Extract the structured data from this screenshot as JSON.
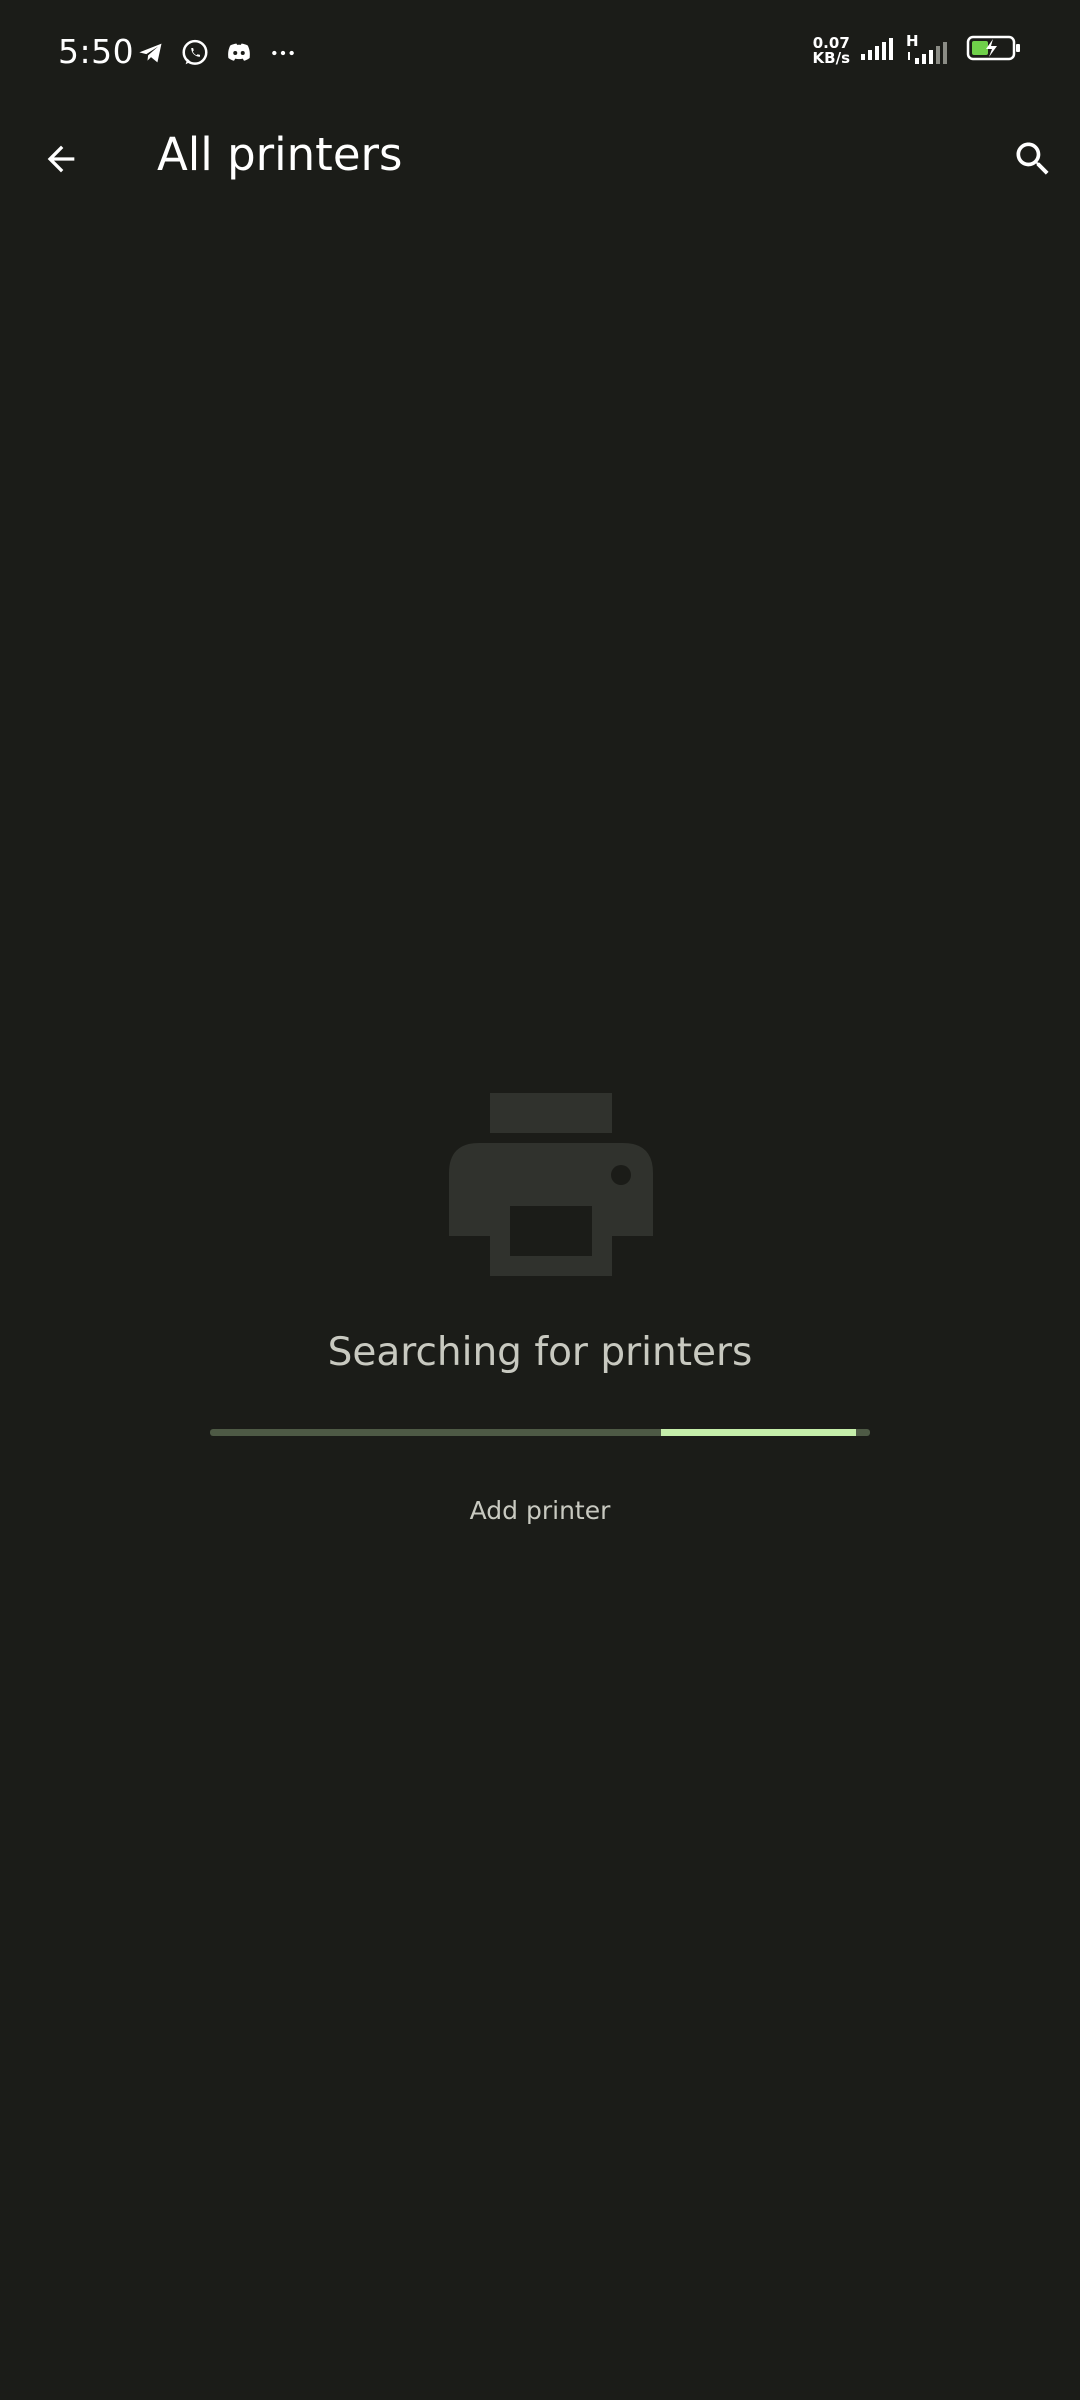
{
  "status_bar": {
    "time": "5:50",
    "notification_icons": [
      "telegram-icon",
      "whatsapp-icon",
      "discord-icon",
      "more-icon"
    ],
    "net_speed_value": "0.07",
    "net_speed_unit": "KB/s",
    "network_type": "H",
    "battery_color": "#6fd04a"
  },
  "app_bar": {
    "title": "All printers",
    "back_icon": "arrow-back-icon",
    "search_icon": "search-icon"
  },
  "empty_state": {
    "icon": "printer-icon",
    "message": "Searching for printers",
    "action_label": "Add printer"
  },
  "colors": {
    "background": "#1b1c18",
    "progress_track": "#4e5a45",
    "progress_indicator": "#c5eeaa",
    "illustration": "#30322d"
  }
}
